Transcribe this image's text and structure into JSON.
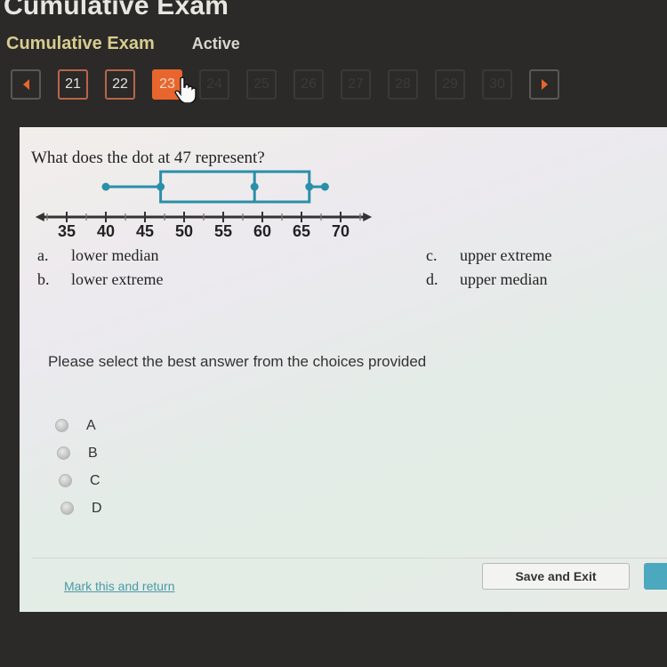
{
  "window": {
    "title": "Cumulative Exam"
  },
  "header": {
    "exam_name": "Cumulative Exam",
    "status": "Active"
  },
  "pager": {
    "prev_icon": "triangle-left-icon",
    "next_icon": "triangle-right-icon",
    "pages": [
      {
        "num": "21",
        "state": "done"
      },
      {
        "num": "22",
        "state": "done"
      },
      {
        "num": "23",
        "state": "current"
      },
      {
        "num": "24",
        "state": "locked"
      },
      {
        "num": "25",
        "state": "locked"
      },
      {
        "num": "26",
        "state": "locked"
      },
      {
        "num": "27",
        "state": "locked"
      },
      {
        "num": "28",
        "state": "locked"
      },
      {
        "num": "29",
        "state": "locked"
      },
      {
        "num": "30",
        "state": "locked"
      }
    ],
    "accent": "#e8662e"
  },
  "question": {
    "text": "What does the dot at 47 represent?",
    "choices": [
      {
        "letter": "a.",
        "text": "lower median"
      },
      {
        "letter": "b.",
        "text": "lower extreme"
      },
      {
        "letter": "c.",
        "text": "upper extreme"
      },
      {
        "letter": "d.",
        "text": "upper median"
      }
    ]
  },
  "chart_data": {
    "type": "boxplot",
    "min": 40,
    "q1": 47,
    "median": 59,
    "q3": 66,
    "max": 68,
    "axis": {
      "range": [
        31,
        74
      ],
      "ticks": [
        35,
        40,
        45,
        50,
        55,
        60,
        65,
        70
      ],
      "minor_step": 2.5
    },
    "color": "#2a8fa8"
  },
  "answer": {
    "instruction": "Please select the best answer from the choices provided",
    "options": [
      "A",
      "B",
      "C",
      "D"
    ]
  },
  "footer": {
    "mark_link": "Mark this and return",
    "save_exit": "Save and Exit"
  },
  "colors": {
    "link": "#4a9aa6",
    "next_button": "#4ba8bf"
  }
}
